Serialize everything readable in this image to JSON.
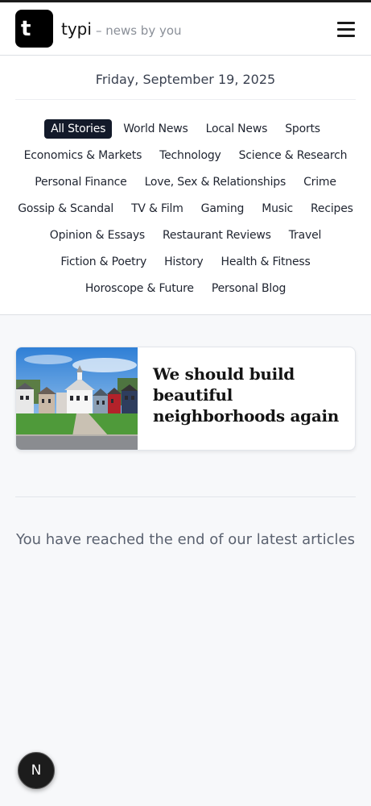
{
  "header": {
    "logo_letter": "t",
    "brand_name": "typi",
    "tagline": "– news by you",
    "menu_icon": "hamburger-icon"
  },
  "date": "Friday, September 19, 2025",
  "categories": {
    "active": "All Stories",
    "rows": [
      [
        "All Stories",
        "World News",
        "Local News",
        "Sports"
      ],
      [
        "Economics & Markets",
        "Technology",
        "Science & Research"
      ],
      [
        "Personal Finance",
        "Love, Sex & Relationships",
        "Crime"
      ],
      [
        "Gossip & Scandal",
        "TV & Film",
        "Gaming",
        "Music",
        "Recipes"
      ],
      [
        "Opinion & Essays",
        "Restaurant Reviews",
        "Travel"
      ],
      [
        "Fiction & Poetry",
        "History",
        "Health & Fitness"
      ],
      [
        "Horoscope & Future",
        "Personal Blog"
      ]
    ]
  },
  "articles": [
    {
      "title": "We should build beautiful neighborhoods again"
    }
  ],
  "end_message": "You have reached the end of our latest articles",
  "dev_badge": {
    "letter": "N"
  },
  "colors": {
    "active_category_bg": "#131a2a",
    "page_bg": "#f7f8fa"
  }
}
